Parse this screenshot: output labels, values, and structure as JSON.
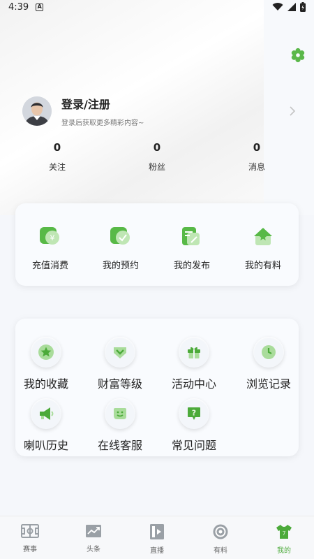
{
  "status_bar": {
    "time": "4:39",
    "badge": "A"
  },
  "colors": {
    "accent_green": "#4caa3a",
    "icon_gray": "#9aa0a6"
  },
  "profile": {
    "title": "登录/注册",
    "subtitle": "登录后获取更多精彩内容~",
    "stats": [
      {
        "value": "0",
        "label": "关注"
      },
      {
        "value": "0",
        "label": "粉丝"
      },
      {
        "value": "0",
        "label": "消息"
      }
    ]
  },
  "quick_actions": [
    {
      "label": "充值消费",
      "icon": "recharge-icon"
    },
    {
      "label": "我的预约",
      "icon": "appointment-icon"
    },
    {
      "label": "我的发布",
      "icon": "publish-icon"
    },
    {
      "label": "我的有料",
      "icon": "my-content-icon"
    }
  ],
  "features": [
    {
      "label": "我的收藏",
      "icon": "star-icon"
    },
    {
      "label": "财富等级",
      "icon": "wealth-level-icon"
    },
    {
      "label": "活动中心",
      "icon": "gift-icon"
    },
    {
      "label": "浏览记录",
      "icon": "clock-icon"
    },
    {
      "label": "喇叭历史",
      "icon": "megaphone-icon"
    },
    {
      "label": "在线客服",
      "icon": "customer-service-icon"
    },
    {
      "label": "常见问题",
      "icon": "question-icon"
    }
  ],
  "tabbar": [
    {
      "label": "赛事",
      "icon": "match-icon"
    },
    {
      "label": "头条",
      "icon": "headline-icon"
    },
    {
      "label": "直播",
      "icon": "live-icon"
    },
    {
      "label": "有料",
      "icon": "content-icon"
    },
    {
      "label": "我的",
      "icon": "profile-tab-icon",
      "active": true
    }
  ]
}
